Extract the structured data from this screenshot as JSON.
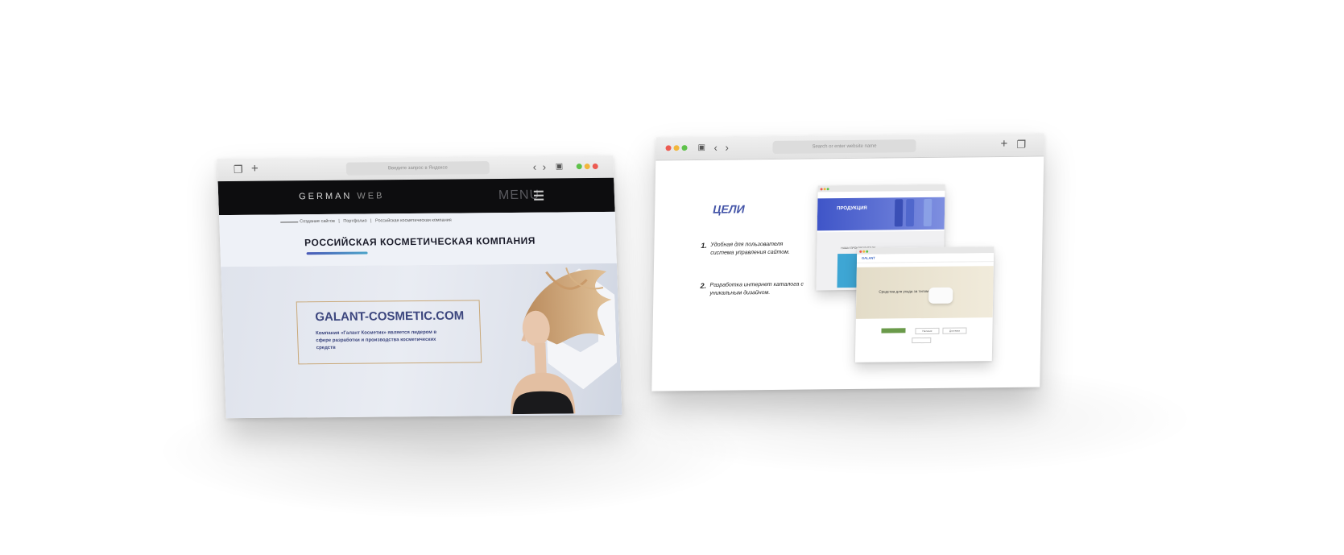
{
  "left_window": {
    "address_placeholder": "Введите запрос в Яндексе",
    "logo_part1": "GERMAN",
    "logo_part2": "WEB",
    "menu_label": "MENU",
    "breadcrumbs": [
      "Создание сайтов",
      "Портфолио",
      "Российская косметическая компания"
    ],
    "page_title": "РОССИЙСКАЯ КОСМЕТИЧЕСКАЯ КОМПАНИЯ",
    "site_name": "GALANT-COSMETIC.COM",
    "site_description": "Компания «Галант Косметик» является лидером в сфере разработки и производства косметических средств"
  },
  "right_window": {
    "address_placeholder": "Search or enter website name",
    "goals_title": "ЦЕЛИ",
    "goals": [
      {
        "num": "1.",
        "text": "Удобная для пользователя система управления сайтом."
      },
      {
        "num": "2.",
        "text": "Разработка интернет каталога с уникальным дизайном."
      }
    ],
    "mini_a": {
      "banner": "ПРОДУКЦИЯ",
      "tag": "НАШИ ПРОИЗВОДИТЕЛИ"
    },
    "mini_b": {
      "logo": "GALANT",
      "hero_text": "Средства для ухода за телом",
      "btn1": "Наличие",
      "btn2": "Доставка"
    }
  },
  "colors": {
    "accent_blue": "#4455a8",
    "site_name_blue": "#3c467e",
    "gold_frame": "#c9a878",
    "dark_header": "#0d0d0f"
  }
}
